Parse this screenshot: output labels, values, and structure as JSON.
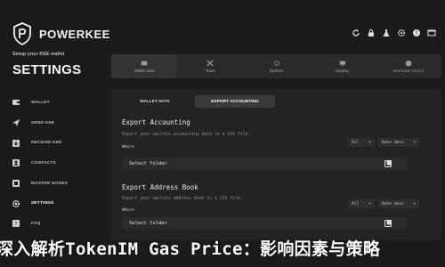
{
  "brand": {
    "name": "POWERKEE",
    "setup_text": "Setup your KEE wallet",
    "page_title": "SETTINGS"
  },
  "sidebar": {
    "items": [
      {
        "label": "WALLET",
        "icon": "wallet-icon",
        "active": false
      },
      {
        "label": "SEND KEE",
        "icon": "send-icon",
        "active": false
      },
      {
        "label": "RECEIVE KEE",
        "icon": "receive-icon",
        "active": false
      },
      {
        "label": "CONTACTS",
        "icon": "contacts-icon",
        "active": false
      },
      {
        "label": "MASTER NODES",
        "icon": "master-nodes-icon",
        "active": false
      },
      {
        "label": "SETTINGS",
        "icon": "gear-icon",
        "active": true
      },
      {
        "label": "FAQ",
        "icon": "faq-icon",
        "active": false
      }
    ]
  },
  "toolbar": {
    "icons": [
      "refresh-icon",
      "lock-icon",
      "flask-icon",
      "settings-icon",
      "help-icon",
      "window-icon"
    ]
  },
  "tabs": [
    {
      "label": "Wallet data",
      "icon": "wallet-data-icon",
      "active": true
    },
    {
      "label": "Tools",
      "icon": "tools-icon",
      "active": false
    },
    {
      "label": "Options",
      "icon": "options-icon",
      "active": false
    },
    {
      "label": "Display",
      "icon": "display-icon",
      "active": false
    },
    {
      "label": "Kee Core V4.3.4",
      "icon": "kee-core-icon",
      "active": false
    }
  ],
  "subtabs": [
    {
      "label": "WALLET DATA",
      "active": false
    },
    {
      "label": "EXPORT ACCOUNTING",
      "active": true
    }
  ],
  "export_accounting": {
    "title": "Export Accounting",
    "description": "Export your wallets accounting data to a CSV file.",
    "where_label": "Where",
    "filter_value": "All",
    "sort_value": "Date desc",
    "folder_placeholder": "Select folder"
  },
  "export_address_book": {
    "title": "Export Address Book",
    "description": "Export your wallets address book to a CSV file.",
    "where_label": "Where",
    "filter_value": "All",
    "sort_value": "Date desc",
    "folder_placeholder": "Select folder"
  },
  "headline": "深入解析TokenIM Gas Price：影响因素与策略",
  "colors": {
    "background": "#1b1b1b",
    "panel": "#232323",
    "accent": "#3a3a3a"
  }
}
